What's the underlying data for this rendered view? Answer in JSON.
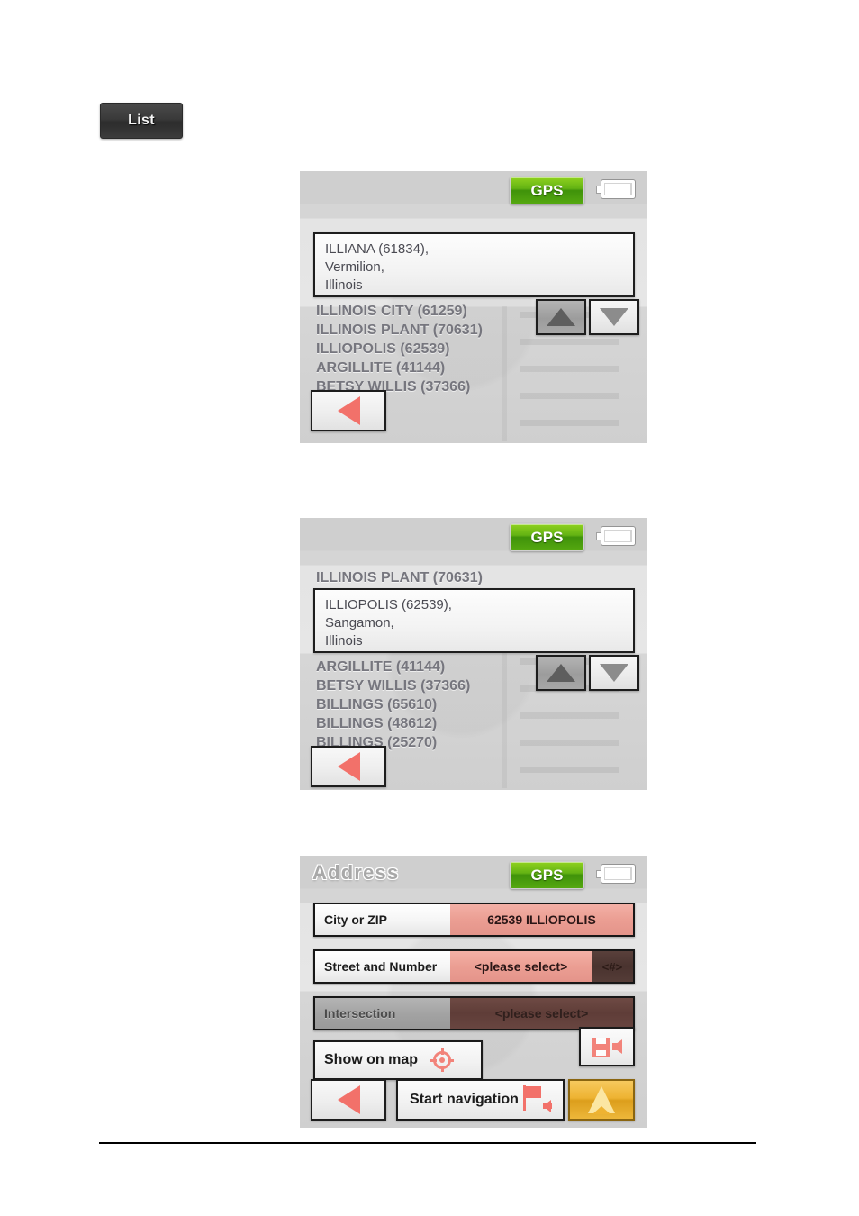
{
  "caption": {
    "list_label": "List"
  },
  "icons": {
    "gps": "gps-badge",
    "battery": "battery-icon",
    "scroll_up": "triangle-up-icon",
    "scroll_down": "triangle-down-icon",
    "back": "triangle-left-icon",
    "target": "crosshair-icon",
    "save": "floppy-disk-icon",
    "flag": "destination-flag-icon",
    "navigate": "navigation-chevron-icon"
  },
  "colors": {
    "gps_green": "#63b313",
    "accent_salmon": "#f2716a",
    "field_value_bg": "#eb9e93",
    "field_disabled_bg": "#5f3d38",
    "go_orange": "#eeb332",
    "screen_bg": "#d9d9d9",
    "list_text": "#76767e"
  },
  "status_bar": {
    "gps_label": "GPS",
    "battery_label": "battery"
  },
  "panels": [
    {
      "id": "panel-city-list-illiana",
      "title": "",
      "header_row": "",
      "selected": {
        "line1": "ILLIANA (61834),",
        "line2": "Vermilion,",
        "line3": "Illinois"
      },
      "list": [
        "ILLINOIS CITY (61259)",
        "ILLINOIS PLANT (70631)",
        "ILLIOPOLIS (62539)",
        "ARGILLITE (41144)",
        "BETSY WILLIS (37366)"
      ]
    },
    {
      "id": "panel-city-list-illiopolis",
      "title": "",
      "header_row": "ILLINOIS PLANT (70631)",
      "selected": {
        "line1": "ILLIOPOLIS (62539),",
        "line2": "Sangamon,",
        "line3": "Illinois"
      },
      "list": [
        "ARGILLITE (41144)",
        "BETSY WILLIS (37366)",
        "BILLINGS (65610)",
        "BILLINGS (48612)",
        "BILLINGS (25270)"
      ]
    }
  ],
  "address_panel": {
    "id": "panel-address",
    "title": "Address",
    "fields": [
      {
        "label": "City or ZIP",
        "value": "62539 ILLIOPOLIS",
        "suffix": "",
        "disabled": false
      },
      {
        "label": "Street and Number",
        "value": "<please select>",
        "suffix": "<#>",
        "disabled": false
      },
      {
        "label": "Intersection",
        "value": "<please select>",
        "suffix": "",
        "disabled": true
      }
    ],
    "show_on_map_label": "Show on map",
    "start_navigation_label": "Start navigation"
  }
}
